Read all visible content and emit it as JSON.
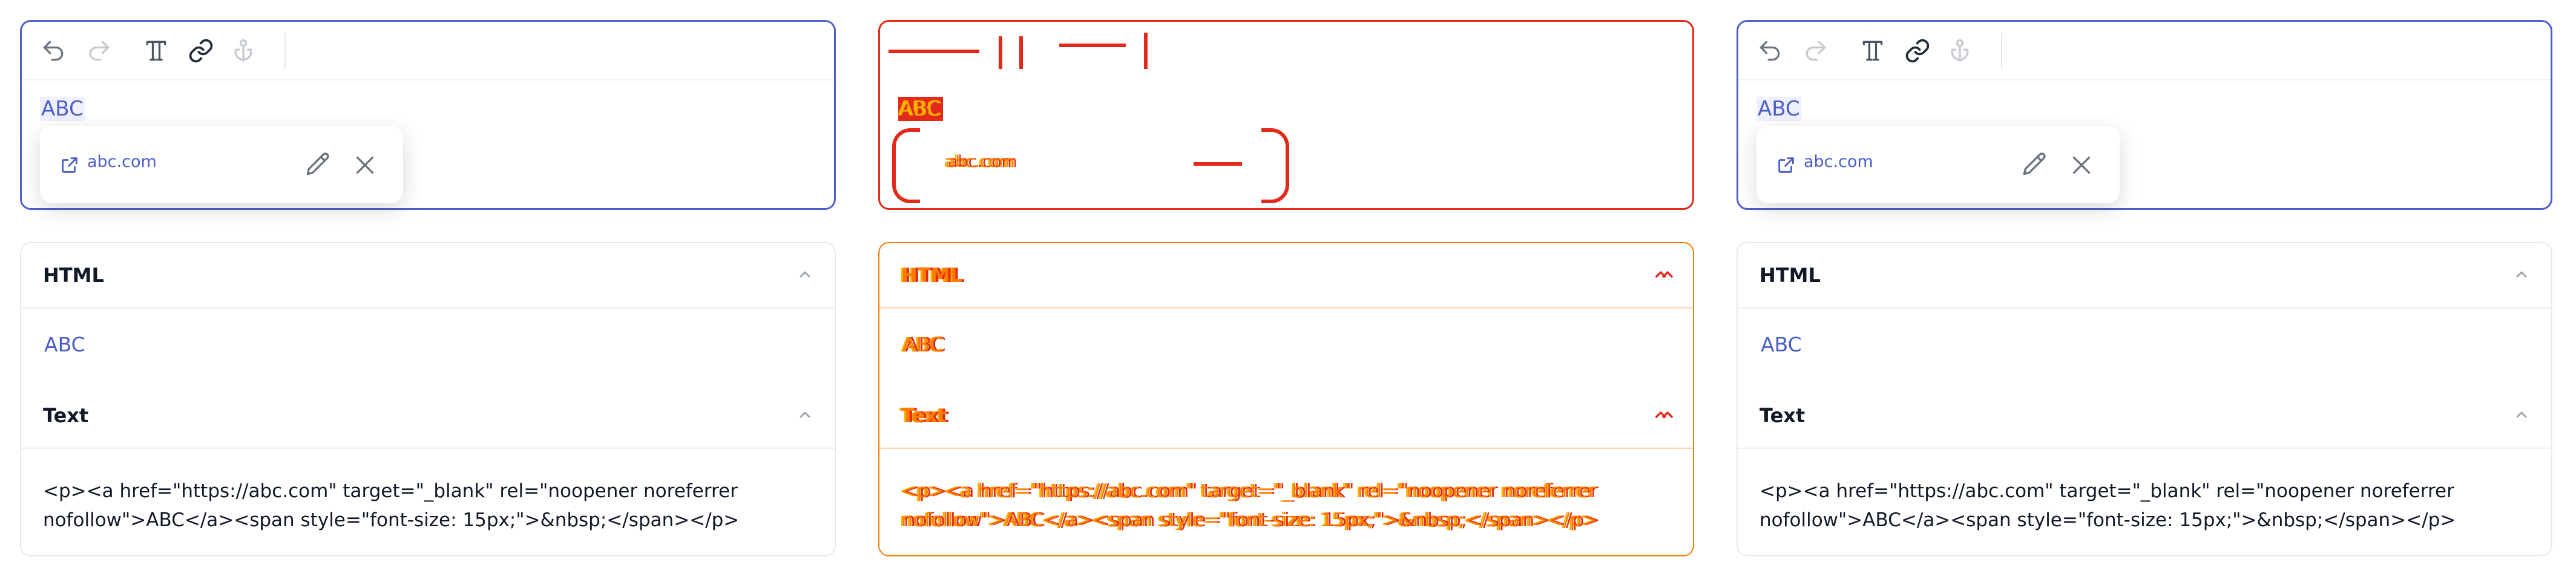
{
  "panels": [
    {
      "id": "left",
      "editor": {
        "toolbar": [
          "undo-icon",
          "redo-icon",
          "font-size-icon",
          "link-icon",
          "anchor-icon"
        ],
        "content_text": "ABC",
        "link_popover": {
          "url": "abc.com",
          "actions": [
            "edit-icon",
            "close-icon"
          ]
        }
      },
      "output": {
        "html_title": "HTML",
        "html_preview": "ABC",
        "text_title": "Text",
        "text_code": "<p><a href=\"https://abc.com\" target=\"_blank\" rel=\"noopener noreferrer nofollow\">ABC</a><span style=\"font-size: 15px;\">&nbsp;</span></p>"
      }
    },
    {
      "id": "middle",
      "editor": {
        "content_text": "ABC",
        "link_popover": {
          "url": "abc.com"
        }
      },
      "output": {
        "html_title": "HTML",
        "html_preview": "ABC",
        "text_title": "Text",
        "text_code": "<p><a href=\"https://abc.com\" target=\"_blank\" rel=\"noopener noreferrer nofollow\">ABC</a><span style=\"font-size: 15px;\">&nbsp;</span></p>"
      }
    },
    {
      "id": "right",
      "editor": {
        "toolbar": [
          "undo-icon",
          "redo-icon",
          "font-size-icon",
          "link-icon",
          "anchor-icon"
        ],
        "content_text": "ABC",
        "link_popover": {
          "url": "abc.com",
          "actions": [
            "edit-icon",
            "close-icon"
          ]
        }
      },
      "output": {
        "html_title": "HTML",
        "html_preview": "ABC",
        "text_title": "Text",
        "text_code": "<p><a href=\"https://abc.com\" target=\"_blank\" rel=\"noopener noreferrer nofollow\">ABC</a><span style=\"font-size: 15px;\">&nbsp;</span></p>"
      }
    }
  ],
  "colors": {
    "accent": "#4b5ec6",
    "border": "#4f5fc8",
    "diff_red": "#e22a1a",
    "diff_orange": "#ff7a00"
  }
}
